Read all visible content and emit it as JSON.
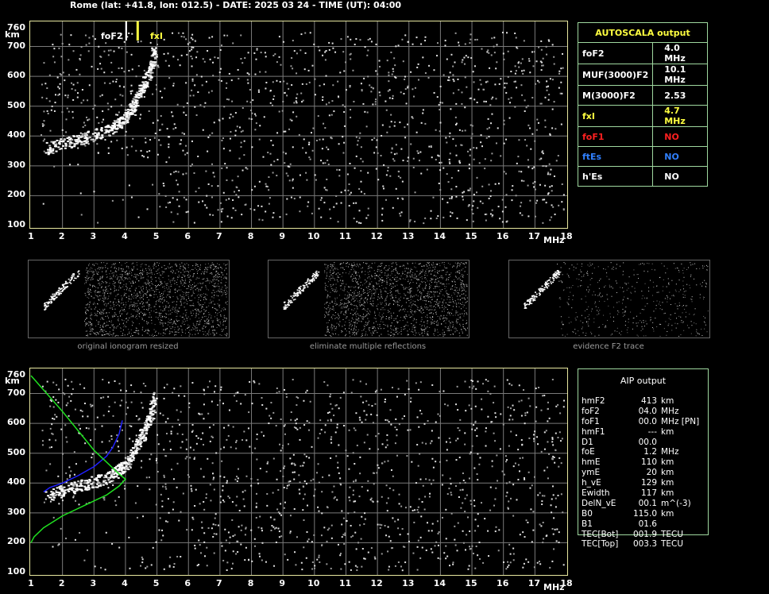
{
  "header": {
    "title": "Rome (lat: +41.8, lon: 012.5) - DATE: 2025 03 24 - TIME (UT): 04:00"
  },
  "axes": {
    "y_ticks": [
      "760",
      "700",
      "600",
      "500",
      "400",
      "300",
      "200",
      "100"
    ],
    "y_unit": "km",
    "x_ticks": [
      "1",
      "2",
      "3",
      "4",
      "5",
      "6",
      "7",
      "8",
      "9",
      "10",
      "11",
      "12",
      "13",
      "14",
      "15",
      "16",
      "17",
      "18"
    ],
    "x_unit": "MHz"
  },
  "markers": {
    "fof2_label": "foF2",
    "fxi_label": "fxI"
  },
  "autoscala": {
    "title": "AUTOSCALA output",
    "rows": [
      {
        "param": "foF2",
        "value": "4.0 MHz",
        "color": "#ffffff",
        "vcolor": "#ffffff"
      },
      {
        "param": "MUF(3000)F2",
        "value": "10.1 MHz",
        "color": "#ffffff",
        "vcolor": "#ffffff"
      },
      {
        "param": "M(3000)F2",
        "value": "2.53",
        "color": "#ffffff",
        "vcolor": "#ffffff"
      },
      {
        "param": "fxI",
        "value": "4.7 MHz",
        "color": "#ffff40",
        "vcolor": "#ffff40"
      },
      {
        "param": "foF1",
        "value": "NO",
        "color": "#ff2020",
        "vcolor": "#ff2020"
      },
      {
        "param": "ftEs",
        "value": "NO",
        "color": "#3080ff",
        "vcolor": "#3080ff"
      },
      {
        "param": "h'Es",
        "value": "NO",
        "color": "#ffffff",
        "vcolor": "#ffffff"
      }
    ]
  },
  "thumbnails": [
    {
      "caption": "original ionogram resized"
    },
    {
      "caption": "eliminate multiple reflections"
    },
    {
      "caption": "evidence F2 trace"
    }
  ],
  "aip": {
    "title": "AIP output",
    "rows": [
      {
        "p": "hmF2",
        "v": "413",
        "u": "km"
      },
      {
        "p": "foF2",
        "v": "04.0",
        "u": "MHz"
      },
      {
        "p": "foF1",
        "v": "00.0",
        "u": "MHz   [PN]"
      },
      {
        "p": "hmF1",
        "v": "---",
        "u": "km"
      },
      {
        "p": "D1",
        "v": "00.0",
        "u": ""
      },
      {
        "p": "foE",
        "v": "1.2",
        "u": "MHz"
      },
      {
        "p": "hmE",
        "v": "110",
        "u": "km"
      },
      {
        "p": "ymE",
        "v": "20",
        "u": "km"
      },
      {
        "p": "h_vE",
        "v": "129",
        "u": "km"
      },
      {
        "p": "Ewidth",
        "v": "117",
        "u": "km"
      },
      {
        "p": "DelN_vE",
        "v": "00.1",
        "u": "m^(-3)"
      },
      {
        "p": "B0",
        "v": "115.0",
        "u": "km"
      },
      {
        "p": "B1",
        "v": "01.6",
        "u": ""
      },
      {
        "p": "TEC[Bot]",
        "v": "001.9",
        "u": "TECU"
      },
      {
        "p": "TEC[Top]",
        "v": "003.3",
        "u": "TECU"
      }
    ]
  },
  "chart_data": [
    {
      "type": "scatter",
      "title": "",
      "xlabel": "MHz",
      "ylabel": "km",
      "xlim": [
        1,
        18
      ],
      "ylim": [
        100,
        760
      ],
      "grid": true,
      "series": [
        {
          "name": "",
          "x": [
            1.5,
            2.0,
            2.5,
            3.0,
            3.5,
            3.8,
            4.0,
            4.2,
            4.4,
            4.6,
            4.8,
            4.9
          ],
          "y": [
            360,
            375,
            390,
            405,
            425,
            445,
            465,
            500,
            540,
            580,
            630,
            690
          ]
        }
      ],
      "markers": [
        {
          "name": "foF2",
          "x": 4.0
        },
        {
          "name": "fxI",
          "x": 4.7
        }
      ]
    },
    {
      "type": "line",
      "title": "",
      "xlabel": "MHz",
      "ylabel": "km",
      "xlim": [
        1,
        18
      ],
      "ylim": [
        100,
        760
      ],
      "grid": true,
      "series": [
        {
          "name": "",
          "color": "#2020ff",
          "x": [
            1.4,
            1.6,
            2.0,
            2.5,
            3.0,
            3.4,
            3.6,
            3.8,
            3.9
          ],
          "y": [
            370,
            385,
            400,
            425,
            455,
            490,
            520,
            565,
            610
          ]
        },
        {
          "name": "",
          "color": "#20e020",
          "x": [
            1.0,
            1.5,
            2.0,
            2.5,
            3.0,
            3.5,
            3.8,
            4.0,
            3.8,
            3.4,
            2.8,
            2.0,
            1.4,
            1.1,
            1.0
          ],
          "y": [
            760,
            700,
            640,
            575,
            510,
            460,
            430,
            413,
            390,
            360,
            330,
            290,
            250,
            220,
            200
          ]
        }
      ]
    }
  ]
}
